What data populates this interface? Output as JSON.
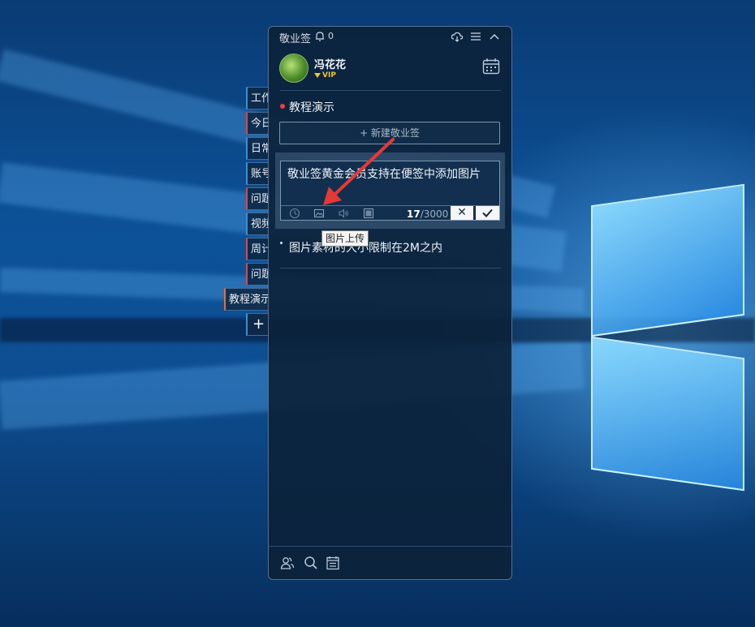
{
  "app": {
    "title": "敬业签",
    "notification_count": "0"
  },
  "user": {
    "name": "冯花花",
    "badge": "VIP"
  },
  "side_tabs": [
    {
      "label": "工作"
    },
    {
      "label": "今日"
    },
    {
      "label": "日常"
    },
    {
      "label": "账号"
    },
    {
      "label": "问题"
    },
    {
      "label": "视频"
    },
    {
      "label": "周计"
    },
    {
      "label": "问题"
    },
    {
      "label": "教程演示"
    }
  ],
  "side_add_label": "+",
  "category": {
    "title": "教程演示",
    "dot_color": "#ef4040"
  },
  "new_note_button": "+ 新建敬业签",
  "editor": {
    "text": "敬业签黄金会员支持在便签中添加图片",
    "char_count": "17",
    "char_max": "/3000",
    "cancel_label": "✕",
    "tool_icons": [
      "clock-icon",
      "image-icon",
      "speaker-icon",
      "square-icon"
    ]
  },
  "tooltip": "图片上传",
  "notes": [
    {
      "text": "图片素材的大小限制在2M之内"
    }
  ],
  "footer_icons": [
    "users-icon",
    "search-icon",
    "notebook-icon"
  ],
  "colors": {
    "accent_red": "#ef4040",
    "vip_gold": "#f2c72a",
    "arrow": "#e53935"
  }
}
